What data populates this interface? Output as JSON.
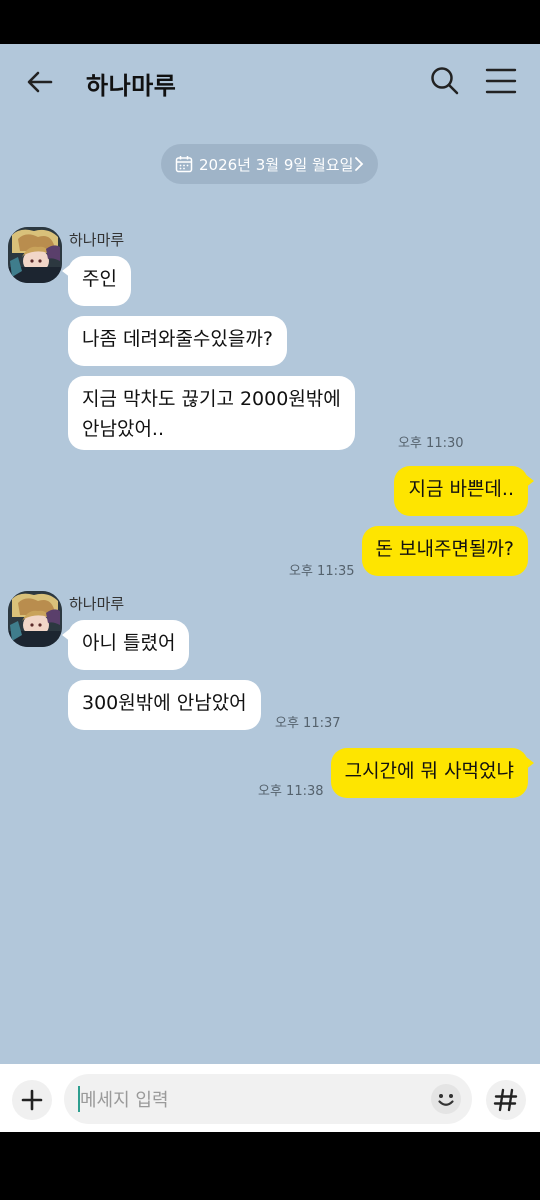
{
  "header": {
    "title": "하나마루",
    "back_icon": "arrow-left-icon",
    "search_icon": "search-icon",
    "menu_icon": "hamburger-menu-icon"
  },
  "date_divider": {
    "text": "2026년 3월 9일 월요일",
    "icon": "calendar-icon"
  },
  "groups": [
    {
      "sender": "하나마루",
      "messages": [
        "주인",
        "나좀 데려와줄수있을까?"
      ],
      "last_message_lines": [
        "지금 막차도 끊기고 2000원밖에",
        "안남았어.."
      ],
      "time": "오후 11:30"
    },
    {
      "outgoing": [
        "지금 바쁜데..",
        "돈 보내주면될까?"
      ],
      "time": "오후 11:35"
    },
    {
      "sender": "하나마루",
      "messages": [
        "아니 틀렸어",
        "300원밖에 안남았어"
      ],
      "time": "오후 11:37"
    },
    {
      "outgoing": [
        "그시간에 뭐 사먹었냐"
      ],
      "time": "오후 11:38"
    }
  ],
  "composer": {
    "placeholder": "메세지 입력",
    "plus_icon": "plus-icon",
    "emoji_icon": "smiley-icon",
    "hash_icon": "hashtag-icon"
  },
  "colors": {
    "chat_background": "#b2c7da",
    "outgoing_bubble": "#fee500",
    "incoming_bubble": "#ffffff"
  }
}
